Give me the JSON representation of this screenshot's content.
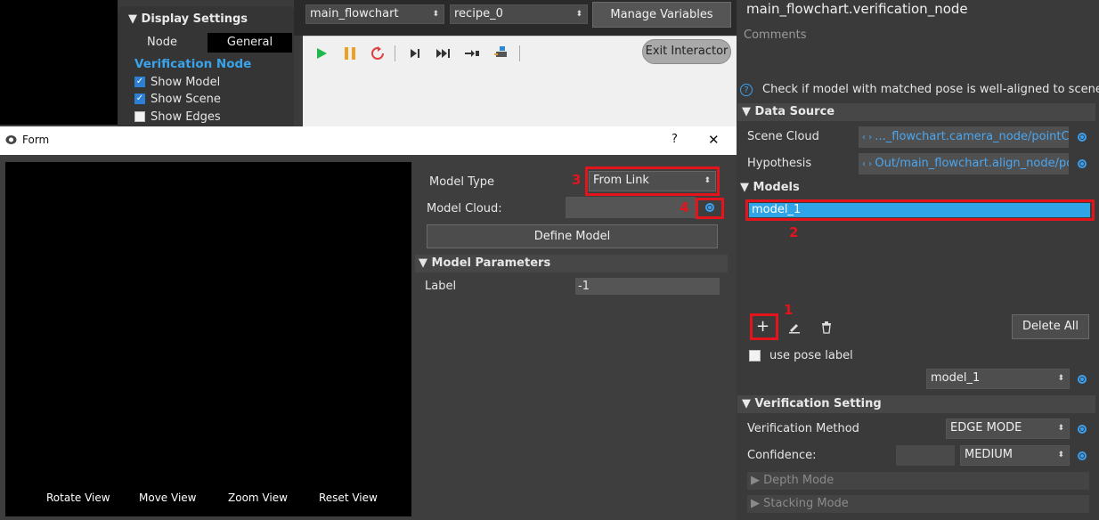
{
  "display_settings": {
    "title": "Display Settings",
    "tabs": [
      "Node",
      "General"
    ],
    "section": "Verification Node",
    "checks": [
      {
        "label": "Show Model",
        "checked": true
      },
      {
        "label": "Show Scene",
        "checked": true
      },
      {
        "label": "Show Edges",
        "checked": false
      }
    ]
  },
  "toolbar": {
    "flowchart_select": "main_flowchart",
    "recipe_select": "recipe_0",
    "manage_variables": "Manage Variables",
    "exit_interactor": "Exit Interactor"
  },
  "form": {
    "title": "Form",
    "help": "?",
    "close": "✕",
    "view_controls": [
      "Rotate View",
      "Move View",
      "Zoom View",
      "Reset View"
    ],
    "model_type_label": "Model Type",
    "model_type_value": "From Link",
    "model_cloud_label": "Model Cloud:",
    "define_model": "Define Model",
    "model_parameters": "Model Parameters",
    "label_label": "Label",
    "label_value": "-1",
    "annotations": {
      "n3": "3",
      "n4": "4"
    }
  },
  "right": {
    "title": "main_flowchart.verification_node",
    "comments": "Comments",
    "description": "Check if model with matched pose is well-aligned to scene cloud",
    "data_source": "Data Source",
    "scene_cloud_label": "Scene Cloud",
    "scene_cloud_value": "..._flowchart.camera_node/pointCloud",
    "hypothesis_label": "Hypothesis",
    "hypothesis_value": "Out/main_flowchart.align_node/poses",
    "models": "Models",
    "model_item": "model_1",
    "annotations": {
      "n1": "1",
      "n2": "2"
    },
    "delete_all": "Delete All",
    "use_pose_label": "use pose label",
    "model_select": "model_1",
    "verification_setting": "Verification Setting",
    "verification_method_label": "Verification Method",
    "verification_method_value": "EDGE MODE",
    "confidence_label": "Confidence:",
    "confidence_value": "MEDIUM",
    "depth_mode": "Depth Mode",
    "stacking_mode": "Stacking Mode"
  },
  "colors": {
    "accent": "#2fa4e7",
    "annotation_red": "#e3141b",
    "play_green": "#1fb84a",
    "pause_orange": "#f0a020",
    "reset_red": "#e04040"
  }
}
